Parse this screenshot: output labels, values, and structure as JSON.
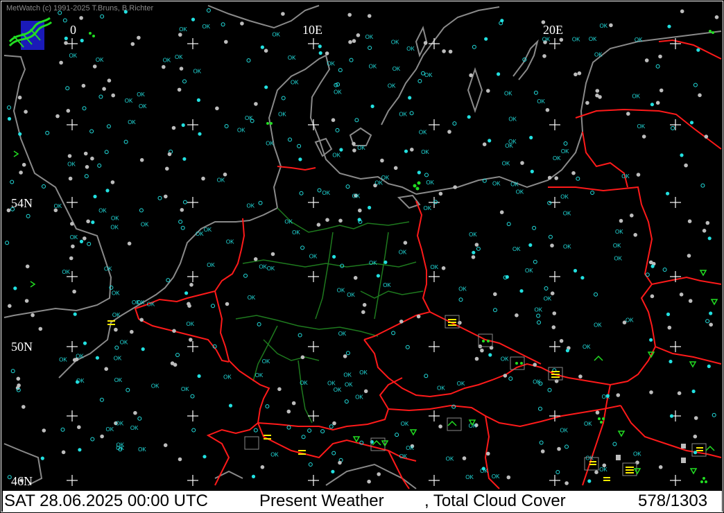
{
  "copyright": "MetWatch  (c) 1991-2025 T.Bruns, B.Richter",
  "longitude_labels": [
    "0",
    "10E",
    "20E"
  ],
  "latitude_labels": [
    "54N",
    "50N",
    "46N"
  ],
  "status": {
    "datetime": "SAT 28.06.2025 00:00 UTC",
    "layer": "Present Weather",
    "overlay": ", Total Cloud Cover",
    "count": "578/1303"
  },
  "station_label": "OK",
  "colors": {
    "background": "#000000",
    "coastline": "#8a8a8a",
    "country_border": "#ff1a1a",
    "state_border": "#1e7a1e",
    "grid_cross": "#ffffff",
    "station_cyan": "#22e0e0",
    "station_grey": "#bdbdbd",
    "weather_green": "#22dd22",
    "weather_yellow": "#ffee00"
  },
  "icons": [
    "metwatch-logo-icon",
    "grid-cross-icon",
    "station-circle-icon",
    "fog-symbol-icon",
    "thunderstorm-symbol-icon",
    "rain-shower-symbol-icon"
  ]
}
